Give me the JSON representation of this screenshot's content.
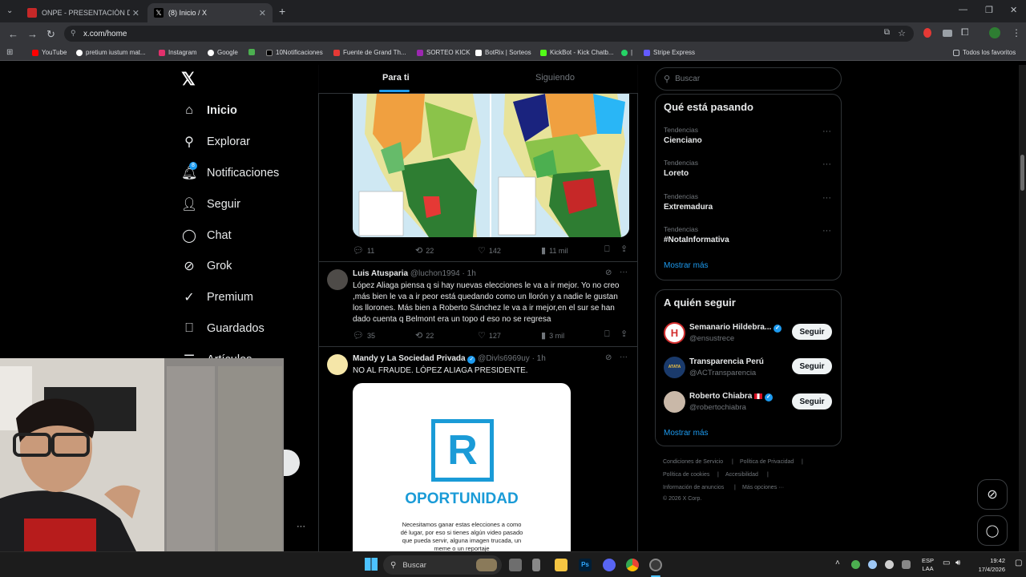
{
  "browser": {
    "tabs": [
      {
        "label": "ONPE - PRESENTACIÓN DE RES",
        "active": false
      },
      {
        "label": "(8) Inicio / X",
        "active": true
      }
    ],
    "url": "x.com/home",
    "bookmarks": [
      "YouTube",
      "pretium iustum mat...",
      "Instagram",
      "Google",
      "10Notificaciones",
      "Fuente de Grand Th...",
      "SORTEO KICK",
      "BotRix | Sorteos",
      "KickBot - Kick Chatb...",
      "|",
      "Stripe Express"
    ],
    "all_bookmarks": "Todos los favoritos"
  },
  "nav": {
    "items": [
      "Inicio",
      "Explorar",
      "Notificaciones",
      "Seguir",
      "Chat",
      "Grok",
      "Premium",
      "Guardados",
      "Artículos"
    ],
    "notif_badge": "8",
    "more": "···"
  },
  "timeline": {
    "tabs": [
      "Para ti",
      "Siguiendo"
    ],
    "tweet1_actions": {
      "replies": "11",
      "retweets": "22",
      "likes": "142",
      "views": "11 mil"
    },
    "tweet2": {
      "name": "Luis Atusparia",
      "handle": "@luchon1994 · 1h",
      "text": "López Aliaga piensa q si hay nuevas elecciones le va a ir mejor. Yo no creo ,más bien le va a ir peor está quedando como un llorón y a nadie le gustan los llorones. Más bien a Roberto Sánchez le va a ir mejor,en el sur se han dado cuenta q Belmont  era un topo d eso no se regresa",
      "actions": {
        "replies": "35",
        "retweets": "22",
        "likes": "127",
        "views": "3 mil"
      }
    },
    "tweet3": {
      "name": "Mandy y La Sociedad Privada",
      "handle": "@Divls6969uy · 1h",
      "text": "NO AL FRAUDE. LÓPEZ ALIAGA PRESIDENTE.",
      "card_title": "OPORTUNIDAD",
      "card_text": "Necesitamos ganar estas elecciones a como dé lugar, por eso si tienes algún video pasado que pueda servir, alguna imagen trucada, un meme o un reportaje"
    }
  },
  "right": {
    "search_placeholder": "Buscar",
    "trends_title": "Qué está pasando",
    "trends": [
      {
        "category": "Tendencias",
        "name": "Cienciano"
      },
      {
        "category": "Tendencias",
        "name": "Loreto"
      },
      {
        "category": "Tendencias",
        "name": "Extremadura"
      },
      {
        "category": "Tendencias",
        "name": "#NotaInformativa"
      }
    ],
    "show_more": "Mostrar más",
    "follow_title": "A quién seguir",
    "follow": [
      {
        "name": "Semanario Hildebra...",
        "handle": "@ensustrece",
        "button": "Seguir",
        "avatar_color": "#d32f2f"
      },
      {
        "name": "Transparencia Perú",
        "handle": "@ACTransparencia",
        "button": "Seguir",
        "avatar_color": "#1a3a6b"
      },
      {
        "name": "Roberto Chiabra",
        "handle": "@robertochiabra",
        "button": "Seguir",
        "avatar_color": "#c9b8a8"
      }
    ],
    "follow_more": "Mostrar más",
    "footer": [
      "Condiciones de Servicio",
      "Política de Privacidad",
      "Política de cookies",
      "Accesibilidad",
      "Información de anuncios",
      "Más opciones ···",
      "© 2026 X Corp."
    ]
  },
  "taskbar": {
    "search": "Buscar",
    "lang": "ESP",
    "lang2": "LAA",
    "time": "19:42",
    "date": "17/4/2026"
  }
}
